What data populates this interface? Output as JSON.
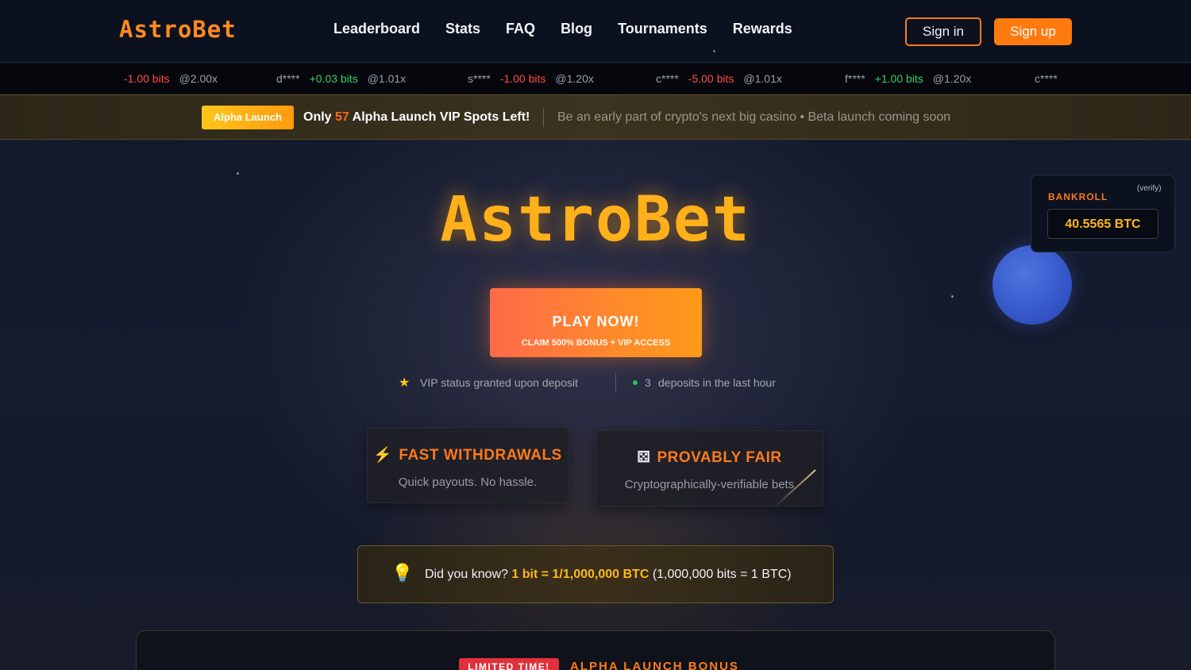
{
  "nav": {
    "logo": "AstroBet",
    "links": [
      "Leaderboard",
      "Stats",
      "FAQ",
      "Blog",
      "Tournaments",
      "Rewards"
    ],
    "signin_label": "Sign in",
    "signup_label": "Sign up"
  },
  "ticker": [
    {
      "user": "",
      "amount": "-1.00 bits",
      "mult": "@2.00x",
      "sign": "neg"
    },
    {
      "user": "d****",
      "amount": "+0.03 bits",
      "mult": "@1.01x",
      "sign": "pos"
    },
    {
      "user": "s****",
      "amount": "-1.00 bits",
      "mult": "@1.20x",
      "sign": "neg"
    },
    {
      "user": "c****",
      "amount": "-5.00 bits",
      "mult": "@1.01x",
      "sign": "neg"
    },
    {
      "user": "f****",
      "amount": "+1.00 bits",
      "mult": "@1.20x",
      "sign": "pos"
    },
    {
      "user": "c****",
      "amount": "",
      "mult": "",
      "sign": "neg"
    }
  ],
  "alpha": {
    "pill": "Alpha Launch",
    "text_before": "Only ",
    "spots": "57",
    "text_after": " Alpha Launch VIP Spots Left!",
    "subtitle": "Be an early part of crypto's next big casino • Beta launch coming soon"
  },
  "hero": {
    "title": "AstroBet",
    "play_label": "PLAY NOW!",
    "play_sub": "CLAIM 500% BONUS + VIP ACCESS",
    "vip_text": "VIP status granted upon deposit",
    "deposit_count": "3",
    "deposit_text": "deposits in the last hour"
  },
  "features": [
    {
      "title": "FAST WITHDRAWALS",
      "desc": "Quick payouts. No hassle.",
      "icon": "lightning-icon"
    },
    {
      "title": "PROVABLY FAIR",
      "desc": "Cryptographically-verifiable bets",
      "icon": "dice-icon"
    }
  ],
  "did_you_know": {
    "prefix": "Did you know? ",
    "highlight": "1 bit = 1/1,000,000 BTC",
    "suffix": " (1,000,000 bits = 1 BTC)"
  },
  "bankroll": {
    "label": "BANKROLL",
    "verify": "(verify)",
    "value": "40.5565 BTC"
  },
  "bonus": {
    "pill": "LIMITED TIME!",
    "title": "ALPHA LAUNCH BONUS"
  },
  "colors": {
    "accent": "#ff7a1a",
    "gold": "#ffb01a",
    "negative": "#ff4a4a",
    "positive": "#33d06a",
    "background": "#151b2e"
  }
}
